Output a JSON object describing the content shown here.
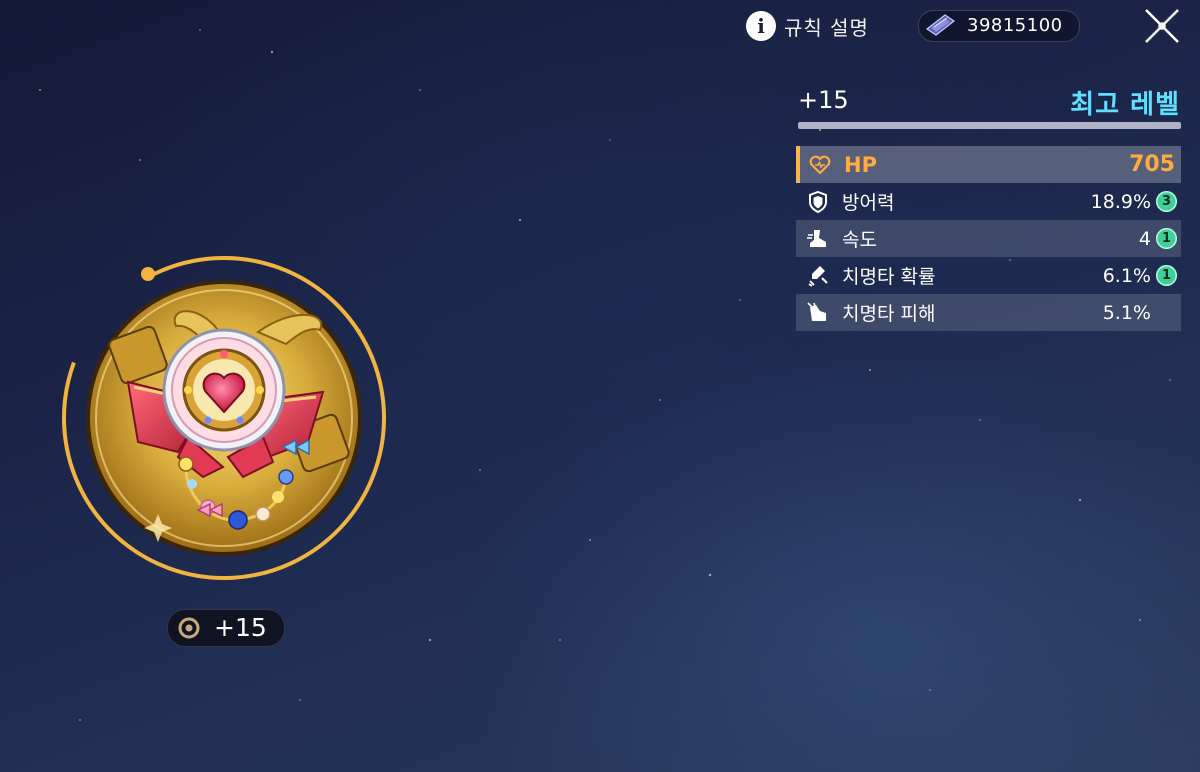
{
  "topbar": {
    "rules_label": "규칙 설명",
    "currency_value": "39815100"
  },
  "header": {
    "current_level": "+15",
    "max_level_label": "최고 레벨"
  },
  "stats": [
    {
      "label": "HP",
      "value": "705",
      "badge": "",
      "icon": "heart-icon"
    },
    {
      "label": "방어력",
      "value": "18.9%",
      "badge": "3",
      "icon": "shield-icon"
    },
    {
      "label": "속도",
      "value": "4",
      "badge": "1",
      "icon": "boot-icon"
    },
    {
      "label": "치명타 확률",
      "value": "6.1%",
      "badge": "1",
      "icon": "crit-chance-icon"
    },
    {
      "label": "치명타 피해",
      "value": "5.1%",
      "badge": "",
      "icon": "crit-damage-icon"
    }
  ],
  "item": {
    "level_label": "+15"
  },
  "colors": {
    "accent_orange": "#ffab3f",
    "max_level_cyan": "#5fe0ff",
    "badge_green": "#3fcf9b",
    "ring_gold": "#f2b441"
  }
}
